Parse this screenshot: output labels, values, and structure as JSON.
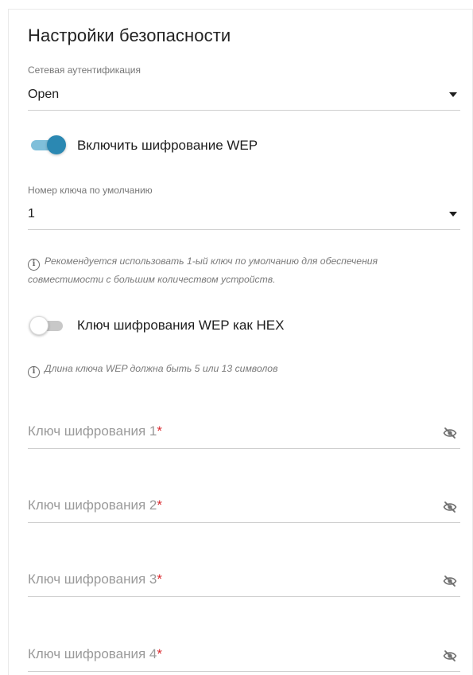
{
  "section": {
    "title": "Настройки безопасности"
  },
  "auth": {
    "label": "Сетевая аутентификация",
    "value": "Open"
  },
  "wep_toggle": {
    "label": "Включить шифрование WEP",
    "state": "on"
  },
  "default_key": {
    "label": "Номер ключа по умолчанию",
    "value": "1"
  },
  "hint1": {
    "line1": "Рекомендуется использовать 1-ый ключ по умолчанию для обеспечения",
    "line2": "совместимости с большим количеством устройств."
  },
  "hex_toggle": {
    "label": "Ключ шифрования WEP как HEX",
    "state": "off"
  },
  "hint2": {
    "text": "Длина ключа WEP должна быть 5 или 13 символов"
  },
  "info_icon_glyph": "i",
  "keys": [
    {
      "placeholder": "Ключ шифрования 1",
      "required_mark": "*"
    },
    {
      "placeholder": "Ключ шифрования 2",
      "required_mark": "*"
    },
    {
      "placeholder": "Ключ шифрования 3",
      "required_mark": "*"
    },
    {
      "placeholder": "Ключ шифрования 4",
      "required_mark": "*"
    }
  ],
  "colors": {
    "accent": "#2b88b2",
    "accent_track": "#7fbfda",
    "required": "#d9262c"
  }
}
